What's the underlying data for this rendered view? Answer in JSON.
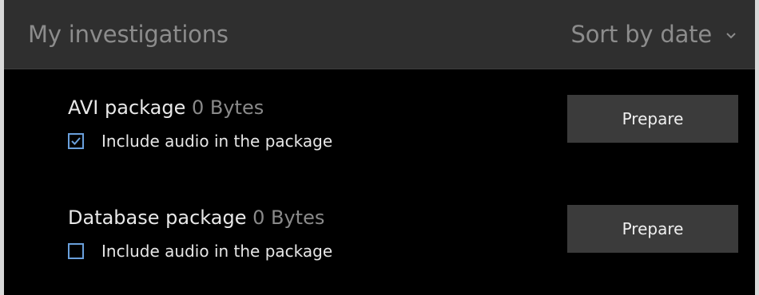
{
  "header": {
    "title": "My investigations",
    "sort_label": "Sort by date",
    "sort_icon": "chevron-down-icon"
  },
  "packages": [
    {
      "name": "AVI package",
      "size": "0 Bytes",
      "checkbox_label": "Include audio in the package",
      "checked": true,
      "button_label": "Prepare"
    },
    {
      "name": "Database package",
      "size": "0 Bytes",
      "checkbox_label": "Include audio in the package",
      "checked": false,
      "button_label": "Prepare"
    }
  ],
  "colors": {
    "background": "#000000",
    "header_bg": "#2f2f2f",
    "muted_text": "#8c8c8c",
    "checkbox_accent": "#6aa0dc",
    "button_bg": "#3b3b3b"
  }
}
